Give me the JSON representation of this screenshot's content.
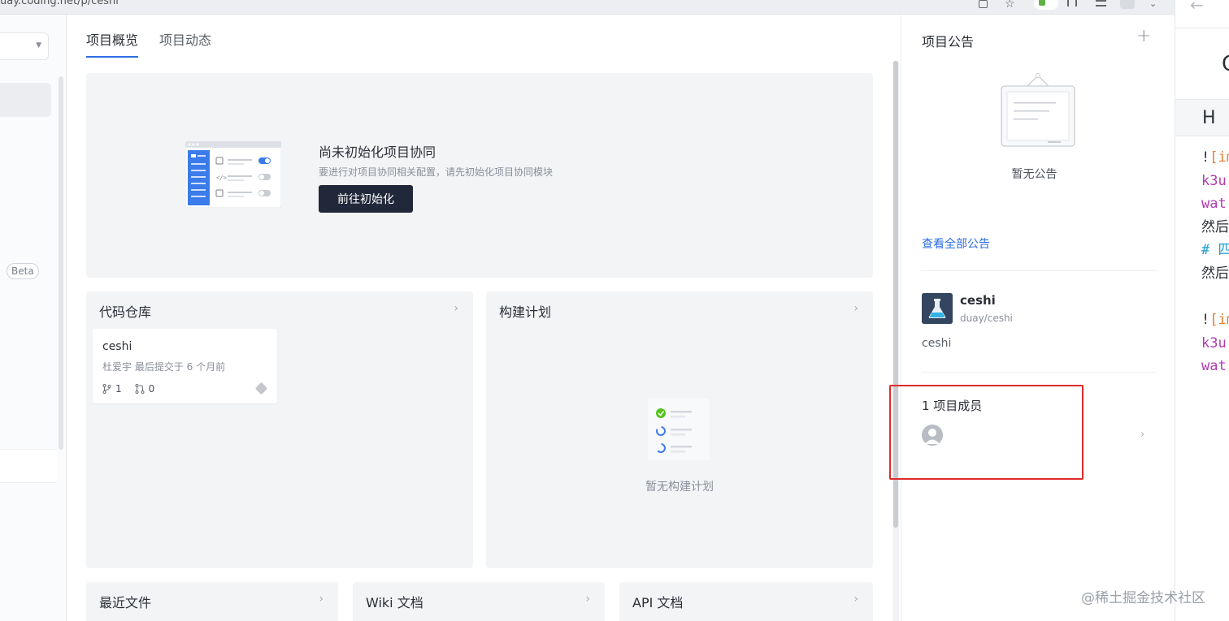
{
  "browser": {
    "url_fragment": "uay.coding.net/p/ceshi"
  },
  "sidebar": {
    "beta_badge": "Beta"
  },
  "tabs": [
    {
      "label": "项目概览",
      "active": true
    },
    {
      "label": "项目动态",
      "active": false
    }
  ],
  "init": {
    "title": "尚未初始化项目协同",
    "description": "要进行对项目协同相关配置，请先初始化项目协同模块",
    "button": "前往初始化"
  },
  "repo_card": {
    "title": "代码仓库",
    "repo": {
      "name": "ceshi",
      "meta": "杜爱宇 最后提交于 6 个月前",
      "branches": "1",
      "merge_requests": "0"
    }
  },
  "build_card": {
    "title": "构建计划",
    "empty_text": "暂无构建计划"
  },
  "bottom_cards": [
    {
      "title": "最近文件"
    },
    {
      "title": "Wiki 文档"
    },
    {
      "title": "API 文档"
    }
  ],
  "right_panel": {
    "announcement_title": "项目公告",
    "announcement_empty": "暂无公告",
    "view_all": "查看全部公告",
    "project": {
      "name": "ceshi",
      "path": "duay/ceshi",
      "description": "ceshi"
    },
    "members_title": "1 项目成员"
  },
  "editor": {
    "big_char": "C",
    "toolbar_char": "H",
    "lines": [
      {
        "parts": [
          {
            "t": "!",
            "c": "dark"
          },
          {
            "t": "[im",
            "c": "orange"
          }
        ]
      },
      {
        "parts": [
          {
            "t": "k3u",
            "c": "purple"
          }
        ]
      },
      {
        "parts": [
          {
            "t": "wat",
            "c": "purple"
          }
        ]
      },
      {
        "parts": [
          {
            "t": "然后",
            "c": "dark"
          }
        ]
      },
      {
        "parts": [
          {
            "t": "# 四",
            "c": "blue"
          }
        ]
      },
      {
        "parts": [
          {
            "t": "然后",
            "c": "dark"
          }
        ]
      },
      {
        "parts": [
          {
            "t": "",
            "c": "dark"
          }
        ]
      },
      {
        "parts": [
          {
            "t": "!",
            "c": "dark"
          },
          {
            "t": "[im",
            "c": "orange"
          }
        ]
      },
      {
        "parts": [
          {
            "t": "k3u",
            "c": "purple"
          }
        ]
      },
      {
        "parts": [
          {
            "t": "wat",
            "c": "purple"
          }
        ]
      }
    ]
  },
  "watermark": "@稀土掘金技术社区",
  "colors": {
    "accent": "#2c6ce6",
    "primary_button": "#20283a",
    "card_bg": "#f3f4f6",
    "highlight": "#e02a2a"
  },
  "icons": {
    "add_announcement": "plus-icon",
    "card_chevron": "chevron-right-icon",
    "branch": "branch-icon",
    "merge_request": "merge-request-icon"
  }
}
